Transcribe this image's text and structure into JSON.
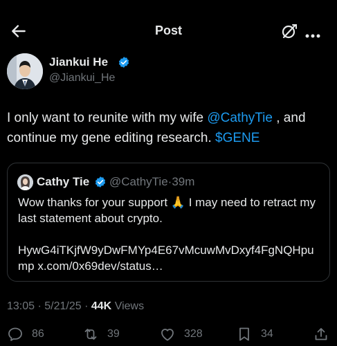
{
  "header": {
    "title": "Post",
    "back_icon": "arrow-left-icon",
    "grok_icon": "grok-icon",
    "more_icon": "more-horizontal-icon"
  },
  "author": {
    "name": "Jiankui He",
    "handle": "@Jiankui_He",
    "verified": true
  },
  "tweet": {
    "text_before": "I only want to reunite with my wife ",
    "mention": "@CathyTie",
    "text_middle": " , and continue my gene editing research. ",
    "cashtag": "$GENE"
  },
  "quote": {
    "name": "Cathy Tie",
    "handle": "@CathyTie",
    "separator": "·",
    "time": "39m",
    "line1_before_emoji": "Wow thanks for your support ",
    "emoji": "🙏",
    "line1_after_emoji": " I may need to retract my last statement about crypto.",
    "line2": "HywG4iTKjfW9yDwFMYp4E67vMcuwMvDxyf4FgNQHpump x.com/0x69dev/status…"
  },
  "meta": {
    "time": "13:05",
    "date": "5/21/25",
    "views_count": "44K",
    "views_label": "Views"
  },
  "actions": {
    "replies": "86",
    "reposts": "39",
    "likes": "328",
    "bookmarks": "34"
  },
  "colors": {
    "background": "#000000",
    "text": "#e7e9ea",
    "secondary": "#71767b",
    "link": "#1d9bf0",
    "verified": "#1d9bf0",
    "border": "#2f3336"
  }
}
